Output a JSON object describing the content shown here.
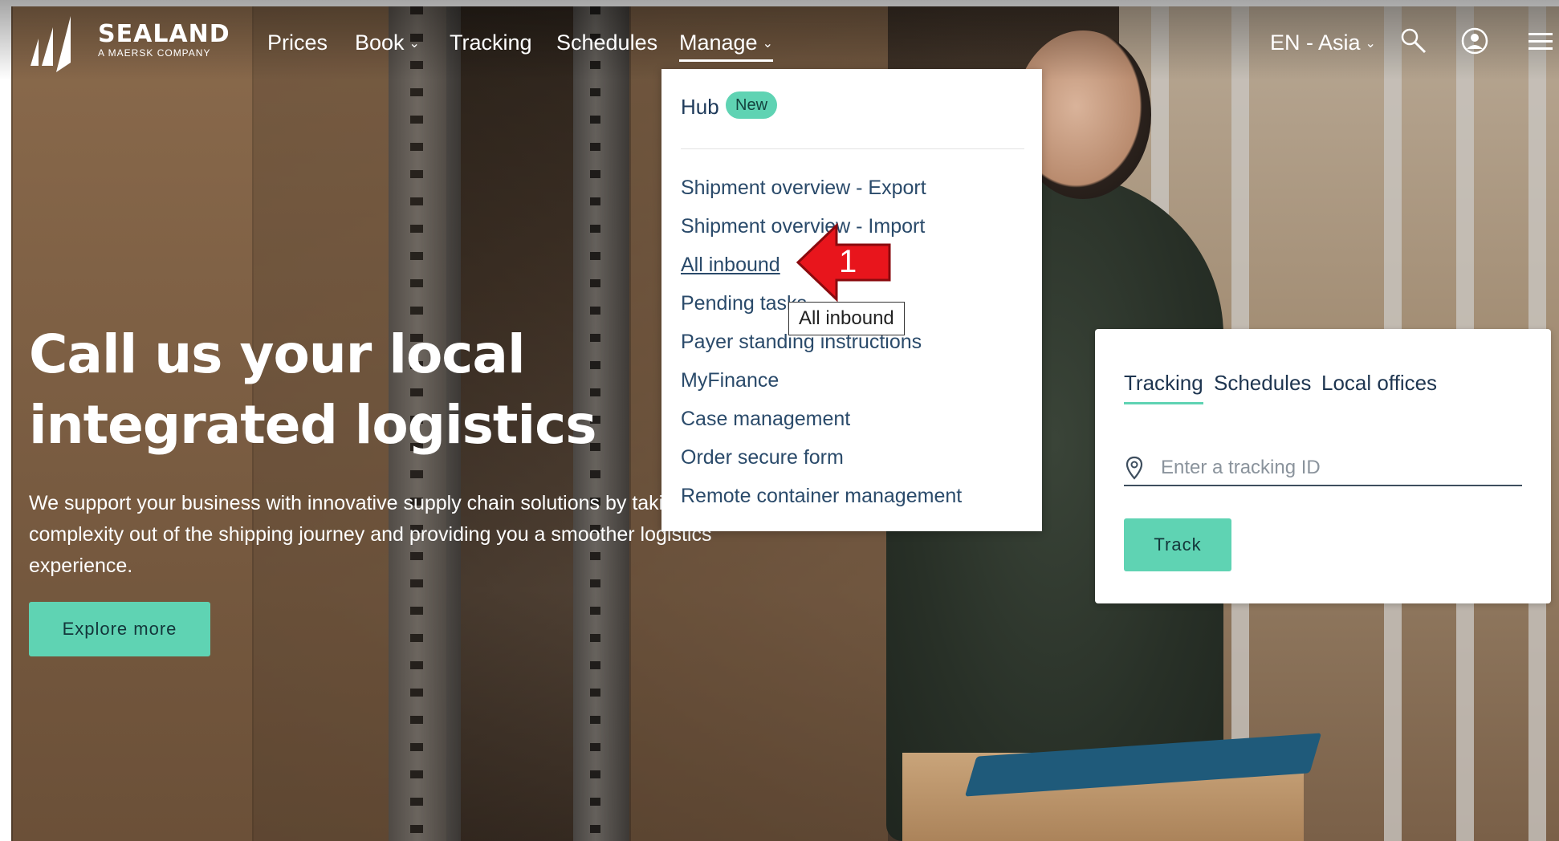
{
  "brand": {
    "name": "SEALAND",
    "tagline": "A MAERSK COMPANY"
  },
  "nav": {
    "items": [
      {
        "label": "Prices"
      },
      {
        "label": "Book",
        "has_dropdown": true
      },
      {
        "label": "Tracking"
      },
      {
        "label": "Schedules"
      },
      {
        "label": "Manage",
        "has_dropdown": true,
        "active": true
      }
    ],
    "locale": "EN - Asia",
    "icons": [
      "search-icon",
      "user-icon",
      "menu-icon"
    ]
  },
  "hero": {
    "title": "Call us your local integrated logistics",
    "description": "We support your business with innovative supply chain solutions by taking the complexity out of the shipping journey and providing you a smoother logistics experience.",
    "cta": "Explore more"
  },
  "manage_menu": {
    "hub": "Hub",
    "hub_badge": "New",
    "items": [
      "Shipment overview - Export",
      "Shipment overview - Import",
      "All inbound",
      "Pending tasks",
      "Payer standing instructions",
      "MyFinance",
      "Case management",
      "Order secure form",
      "Remote container management"
    ],
    "hovered_item": "All inbound"
  },
  "annotation": {
    "step": "1",
    "tooltip": "All inbound"
  },
  "tracking_widget": {
    "tabs": [
      {
        "label": "Tracking",
        "active": true
      },
      {
        "label": "Schedules"
      },
      {
        "label": "Local offices"
      }
    ],
    "input_placeholder": "Enter a tracking ID",
    "button": "Track"
  },
  "colors": {
    "accent": "#5fd3b3",
    "annotation_red": "#e8151c",
    "link_text": "#2a4a6a"
  }
}
